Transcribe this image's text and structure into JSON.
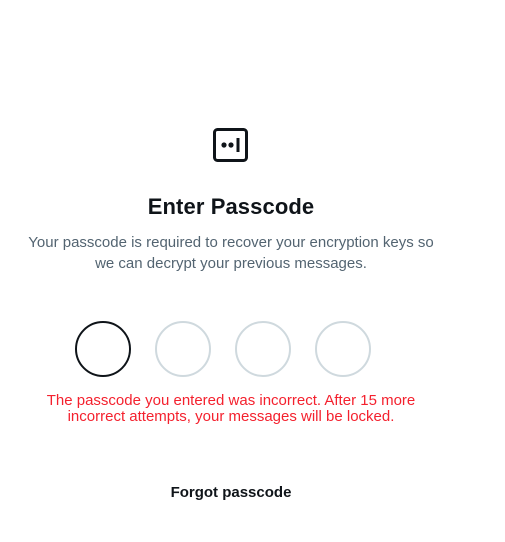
{
  "header": {
    "icon": "passcode-icon",
    "title": "Enter Passcode",
    "subtitle": "Your passcode is required to recover your encryption keys so we can decrypt your previous messages."
  },
  "passcode": {
    "length": 4,
    "entered_count": 0,
    "focused_index": 0
  },
  "error": {
    "message": "The passcode you entered was incorrect. After 15 more incorrect attempts, your messages will be locked."
  },
  "actions": {
    "forgot_label": "Forgot passcode"
  },
  "colors": {
    "text_primary": "#0f1419",
    "text_secondary": "#536471",
    "error": "#f4212e",
    "dot_border": "#cfd9de",
    "dot_active_border": "#0f1419"
  }
}
